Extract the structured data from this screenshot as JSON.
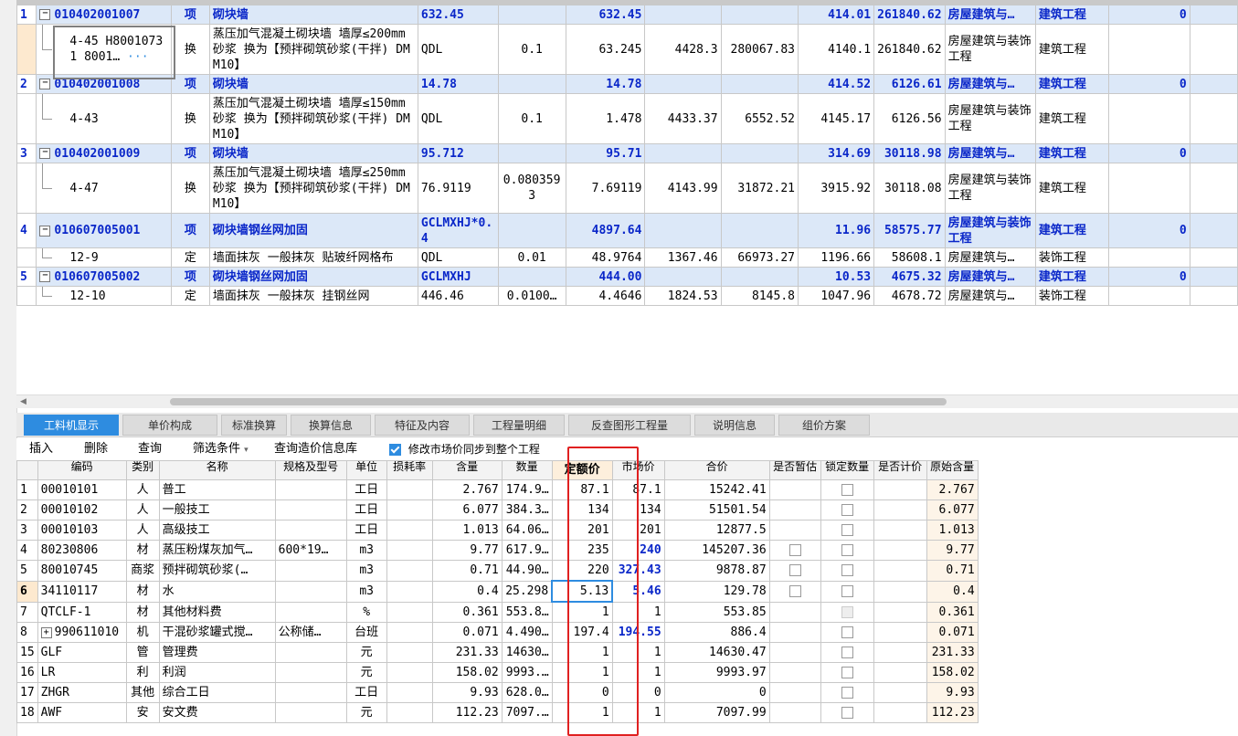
{
  "top_rows": [
    {
      "no": "1",
      "code": "010402001007",
      "type": "项",
      "name": "砌块墙",
      "expr": "632.45",
      "content": "",
      "qty": "632.45",
      "price": "",
      "total": "",
      "unit_price": "414.01",
      "sum": "261840.62",
      "major": "房屋建筑与…",
      "prof": "建筑工程",
      "last": "0",
      "blue": true,
      "lines": 1
    },
    {
      "no": "",
      "code": "4-45 H8001073 1 8001…",
      "type": "换",
      "name": "蒸压加气混凝土砌块墙 墙厚≤200mm 砂浆 换为【预拌砌筑砂浆(干拌) DM M10】",
      "expr": "QDL",
      "content": "0.1",
      "qty": "63.245",
      "price": "4428.3",
      "total": "280067.83",
      "unit_price": "4140.1",
      "sum": "261840.62",
      "major": "房屋建筑与装饰工程",
      "prof": "建筑工程",
      "last": "",
      "blue": false,
      "lines": 3
    },
    {
      "no": "2",
      "code": "010402001008",
      "type": "项",
      "name": "砌块墙",
      "expr": "14.78",
      "content": "",
      "qty": "14.78",
      "price": "",
      "total": "",
      "unit_price": "414.52",
      "sum": "6126.61",
      "major": "房屋建筑与…",
      "prof": "建筑工程",
      "last": "0",
      "blue": true,
      "lines": 1
    },
    {
      "no": "",
      "code": "4-43",
      "type": "换",
      "name": "蒸压加气混凝土砌块墙 墙厚≤150mm 砂浆 换为【预拌砌筑砂浆(干拌) DM M10】",
      "expr": "QDL",
      "content": "0.1",
      "qty": "1.478",
      "price": "4433.37",
      "total": "6552.52",
      "unit_price": "4145.17",
      "sum": "6126.56",
      "major": "房屋建筑与装饰工程",
      "prof": "建筑工程",
      "last": "",
      "blue": false,
      "lines": 3
    },
    {
      "no": "3",
      "code": "010402001009",
      "type": "项",
      "name": "砌块墙",
      "expr": "95.712",
      "content": "",
      "qty": "95.71",
      "price": "",
      "total": "",
      "unit_price": "314.69",
      "sum": "30118.98",
      "major": "房屋建筑与…",
      "prof": "建筑工程",
      "last": "0",
      "blue": true,
      "lines": 1
    },
    {
      "no": "",
      "code": "4-47",
      "type": "换",
      "name": "蒸压加气混凝土砌块墙 墙厚≤250mm 砂浆 换为【预拌砌筑砂浆(干拌) DM M10】",
      "expr": "76.9119",
      "content": "0.0803593",
      "qty": "7.69119",
      "price": "4143.99",
      "total": "31872.21",
      "unit_price": "3915.92",
      "sum": "30118.08",
      "major": "房屋建筑与装饰工程",
      "prof": "建筑工程",
      "last": "",
      "blue": false,
      "lines": 3
    },
    {
      "no": "4",
      "code": "010607005001",
      "type": "项",
      "name": "砌块墙钢丝网加固",
      "expr": "GCLMXHJ*0.4",
      "content": "",
      "qty": "4897.64",
      "price": "",
      "total": "",
      "unit_price": "11.96",
      "sum": "58575.77",
      "major": "房屋建筑与装饰工程",
      "prof": "建筑工程",
      "last": "0",
      "blue": true,
      "lines": 2
    },
    {
      "no": "",
      "code": "12-9",
      "type": "定",
      "name": "墙面抹灰 一般抹灰 贴玻纤网格布",
      "expr": "QDL",
      "content": "0.01",
      "qty": "48.9764",
      "price": "1367.46",
      "total": "66973.27",
      "unit_price": "1196.66",
      "sum": "58608.1",
      "major": "房屋建筑与…",
      "prof": "装饰工程",
      "last": "",
      "blue": false,
      "lines": 1
    },
    {
      "no": "5",
      "code": "010607005002",
      "type": "项",
      "name": "砌块墙钢丝网加固",
      "expr": "GCLMXHJ",
      "content": "",
      "qty": "444.00",
      "price": "",
      "total": "",
      "unit_price": "10.53",
      "sum": "4675.32",
      "major": "房屋建筑与…",
      "prof": "建筑工程",
      "last": "0",
      "blue": true,
      "lines": 1
    },
    {
      "no": "",
      "code": "12-10",
      "type": "定",
      "name": "墙面抹灰 一般抹灰 挂钢丝网",
      "expr": "446.46",
      "content": "0.0100…",
      "qty": "4.4646",
      "price": "1824.53",
      "total": "8145.8",
      "unit_price": "1047.96",
      "sum": "4678.72",
      "major": "房屋建筑与…",
      "prof": "装饰工程",
      "last": "",
      "blue": false,
      "lines": 1
    }
  ],
  "tabs": [
    "工料机显示",
    "单价构成",
    "标准换算",
    "换算信息",
    "特征及内容",
    "工程量明细",
    "反查图形工程量",
    "说明信息",
    "组价方案"
  ],
  "toolbar": {
    "insert": "插入",
    "delete": "删除",
    "query": "查询",
    "filter": "筛选条件",
    "query_price": "查询造价信息库",
    "sync_label": "修改市场价同步到整个工程"
  },
  "bottom_headers": [
    "编码",
    "类别",
    "名称",
    "规格及型号",
    "单位",
    "损耗率",
    "含量",
    "数量",
    "定额价",
    "市场价",
    "合价",
    "是否暂估",
    "锁定数量",
    "是否计价",
    "原始含量"
  ],
  "bottom_rows": [
    {
      "no": "1",
      "code": "00010101",
      "cat": "人",
      "name": "普工",
      "spec": "",
      "unit": "工日",
      "qty": "2.767",
      "amount": "174.9…",
      "quota": "87.1",
      "market": "87.1",
      "mblue": false,
      "total": "15242.41",
      "c1": false,
      "c2": "off",
      "orig": "2.767"
    },
    {
      "no": "2",
      "code": "00010102",
      "cat": "人",
      "name": "一般技工",
      "spec": "",
      "unit": "工日",
      "qty": "6.077",
      "amount": "384.3…",
      "quota": "134",
      "market": "134",
      "mblue": false,
      "total": "51501.54",
      "c1": false,
      "c2": "off",
      "orig": "6.077"
    },
    {
      "no": "3",
      "code": "00010103",
      "cat": "人",
      "name": "高级技工",
      "spec": "",
      "unit": "工日",
      "qty": "1.013",
      "amount": "64.06…",
      "quota": "201",
      "market": "201",
      "mblue": false,
      "total": "12877.5",
      "c1": false,
      "c2": "off",
      "orig": "1.013"
    },
    {
      "no": "4",
      "code": "80230806",
      "cat": "材",
      "name": "蒸压粉煤灰加气…",
      "spec": "600*19…",
      "unit": "m3",
      "qty": "9.77",
      "amount": "617.9…",
      "quota": "235",
      "market": "240",
      "mblue": true,
      "total": "145207.36",
      "c1": true,
      "c2": "off",
      "orig": "9.77"
    },
    {
      "no": "5",
      "code": "80010745",
      "cat": "商浆",
      "name": "预拌砌筑砂浆(…",
      "spec": "",
      "unit": "m3",
      "qty": "0.71",
      "amount": "44.90…",
      "quota": "220",
      "market": "327.43",
      "mblue": true,
      "total": "9878.87",
      "c1": true,
      "c2": "off",
      "orig": "0.71"
    },
    {
      "no": "6",
      "code": "34110117",
      "cat": "材",
      "name": "水",
      "spec": "",
      "unit": "m3",
      "qty": "0.4",
      "amount": "25.298",
      "quota": "5.13",
      "market": "5.46",
      "mblue": true,
      "total": "129.78",
      "c1": true,
      "c2": "off",
      "orig": "0.4"
    },
    {
      "no": "7",
      "code": "QTCLF-1",
      "cat": "材",
      "name": "其他材料费",
      "spec": "",
      "unit": "%",
      "qty": "0.361",
      "amount": "553.8…",
      "quota": "1",
      "market": "1",
      "mblue": false,
      "total": "553.85",
      "c1": false,
      "c2": "dis",
      "orig": "0.361"
    },
    {
      "no": "8",
      "code": "990611010",
      "cat": "机",
      "name": "干混砂浆罐式搅…",
      "spec": "公称储…",
      "unit": "台班",
      "qty": "0.071",
      "amount": "4.490…",
      "quota": "197.4",
      "market": "194.55",
      "mblue": true,
      "total": "886.4",
      "c1": false,
      "c2": "off",
      "orig": "0.071"
    },
    {
      "no": "15",
      "code": "GLF",
      "cat": "管",
      "name": "管理费",
      "spec": "",
      "unit": "元",
      "qty": "231.33",
      "amount": "14630…",
      "quota": "1",
      "market": "1",
      "mblue": false,
      "total": "14630.47",
      "c1": false,
      "c2": "off",
      "orig": "231.33"
    },
    {
      "no": "16",
      "code": "LR",
      "cat": "利",
      "name": "利润",
      "spec": "",
      "unit": "元",
      "qty": "158.02",
      "amount": "9993.…",
      "quota": "1",
      "market": "1",
      "mblue": false,
      "total": "9993.97",
      "c1": false,
      "c2": "off",
      "orig": "158.02"
    },
    {
      "no": "17",
      "code": "ZHGR",
      "cat": "其他",
      "name": "综合工日",
      "spec": "",
      "unit": "工日",
      "qty": "9.93",
      "amount": "628.0…",
      "quota": "0",
      "market": "0",
      "mblue": false,
      "total": "0",
      "c1": false,
      "c2": "off",
      "orig": "9.93"
    },
    {
      "no": "18",
      "code": "AWF",
      "cat": "安",
      "name": "安文费",
      "spec": "",
      "unit": "元",
      "qty": "112.23",
      "amount": "7097.…",
      "quota": "1",
      "market": "1",
      "mblue": false,
      "total": "7097.99",
      "c1": false,
      "c2": "off",
      "orig": "112.23"
    }
  ],
  "colors": {
    "accent": "#2e8ce0",
    "row_blue": "#dce8f8",
    "highlight_border": "#e02020",
    "market_blue": "#0a27c9"
  }
}
